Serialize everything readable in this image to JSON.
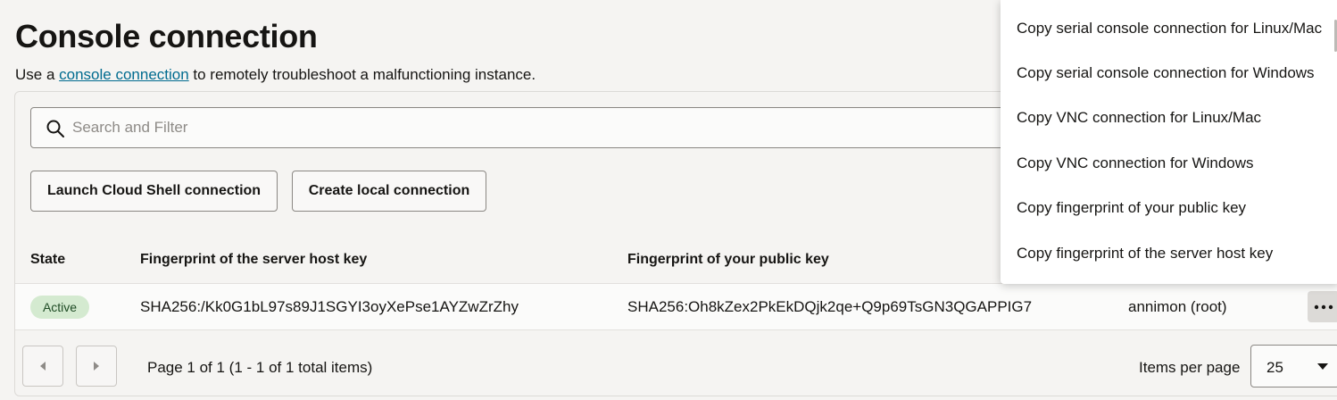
{
  "page": {
    "title": "Console connection",
    "subtitle_prefix": "Use a ",
    "subtitle_link": "console connection",
    "subtitle_suffix": " to remotely troubleshoot a malfunctioning instance."
  },
  "search": {
    "placeholder": "Search and Filter",
    "icon": "search-icon"
  },
  "actions": {
    "launch_cloud_shell": "Launch Cloud Shell connection",
    "create_local": "Create local connection"
  },
  "table": {
    "columns": {
      "state": "State",
      "server_fingerprint": "Fingerprint of the server host key",
      "public_fingerprint": "Fingerprint of your public key"
    },
    "rows": [
      {
        "state": "Active",
        "server_fingerprint": "SHA256:/Kk0G1bL97s89J1SGYI3oyXePse1AYZwZrZhy",
        "public_fingerprint": "SHA256:Oh8kZex2PkEkDQjk2qe+Q9p69TsGN3QGAPPIG7",
        "user": "annimon (root)",
        "status_color": "#d4ead0"
      }
    ]
  },
  "pagination": {
    "page_info": "Page 1 of 1 (1 - 1 of 1 total items)",
    "items_per_page_label": "Items per page",
    "items_per_page_value": "25"
  },
  "context_menu": {
    "items": [
      "Copy serial console connection for Linux/Mac",
      "Copy serial console connection for Windows",
      "Copy VNC connection for Linux/Mac",
      "Copy VNC connection for Windows",
      "Copy fingerprint of your public key",
      "Copy fingerprint of the server host key"
    ]
  },
  "colors": {
    "link": "#006b8f",
    "badge_bg": "#d4ead0",
    "badge_text": "#1e4b24"
  }
}
